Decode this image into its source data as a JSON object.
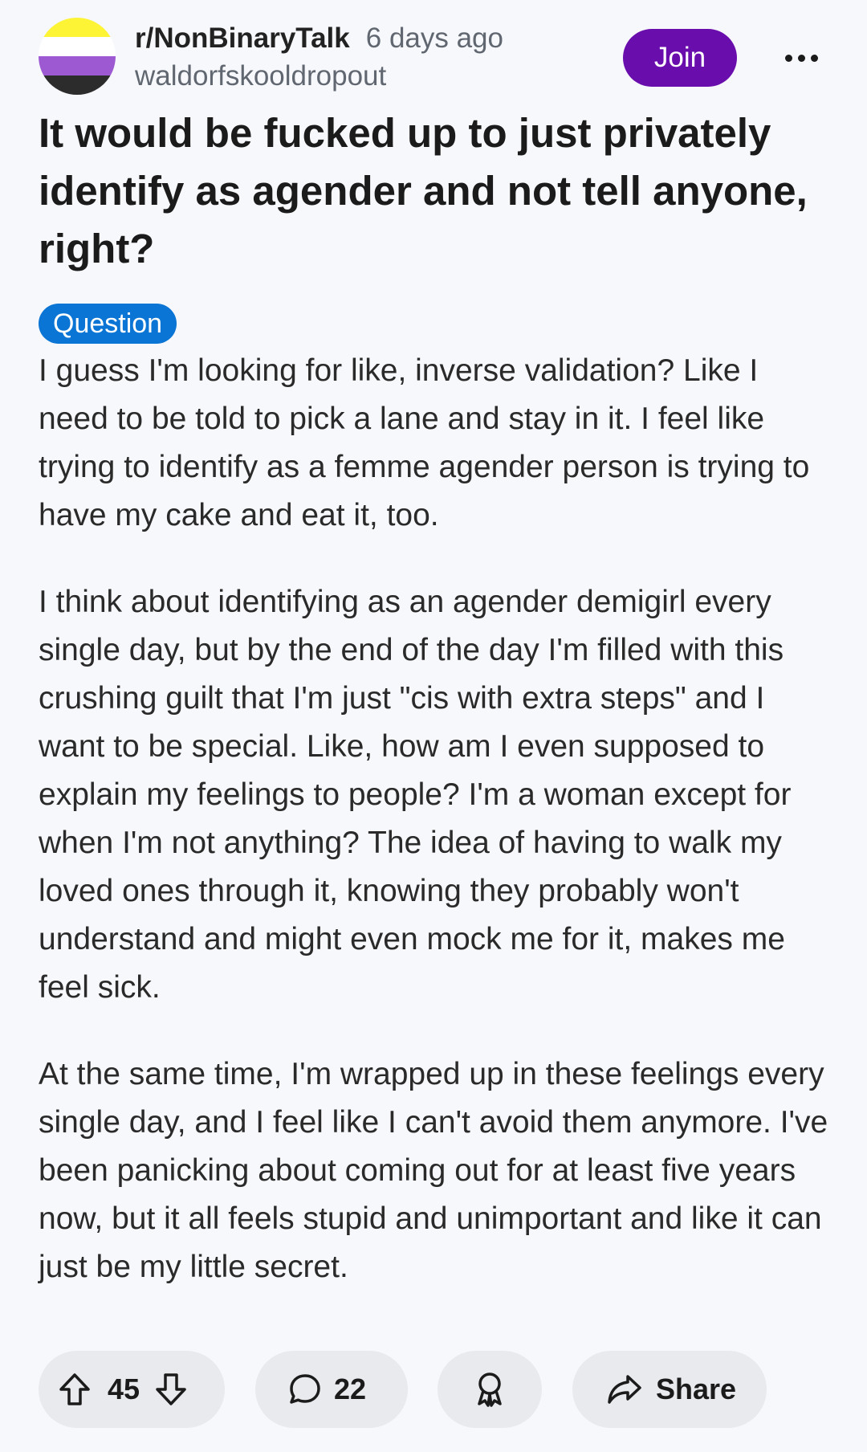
{
  "post": {
    "subreddit": "r/NonBinaryTalk",
    "time": "6 days ago",
    "username": "waldorfskooldropout",
    "join_label": "Join",
    "title": "It would be fucked up to just privately identify as agender and not tell anyone, right?",
    "flair": "Question",
    "paragraphs": [
      "I guess I'm looking for like, inverse validation? Like I need to be told to pick a lane and stay in it. I feel like trying to identify as a femme agender person is trying to have my cake and eat it, too.",
      "I think about identifying as an agender demigirl every single day, but by the end of the day I'm filled with this crushing guilt that I'm just \"cis with extra steps\" and I want to be special. Like, how am I even supposed to explain my feelings to people? I'm a woman except for when I'm not anything? The idea of having to walk my loved ones through it, knowing they probably won't understand and might even mock me for it, makes me feel sick.",
      "At the same time, I'm wrapped up in these feelings every single day, and I feel like I can't avoid them anymore. I've been panicking about coming out for at least five years now, but it all feels stupid and unimportant and like it can just be my little secret."
    ]
  },
  "actions": {
    "votes": "45",
    "comments": "22",
    "share_label": "Share"
  },
  "icons": {
    "avatar": "nonbinary-flag-icon",
    "more": "more-dots-icon",
    "upvote": "upvote-arrow-icon",
    "downvote": "downvote-arrow-icon",
    "comment": "comment-bubble-icon",
    "award": "award-ribbon-icon",
    "share": "share-arrow-icon"
  },
  "colors": {
    "join": "#6a0dad",
    "flair": "#0a75d4",
    "flag": [
      "#fcf434",
      "#ffffff",
      "#9c59d1",
      "#2c2c2c"
    ]
  }
}
